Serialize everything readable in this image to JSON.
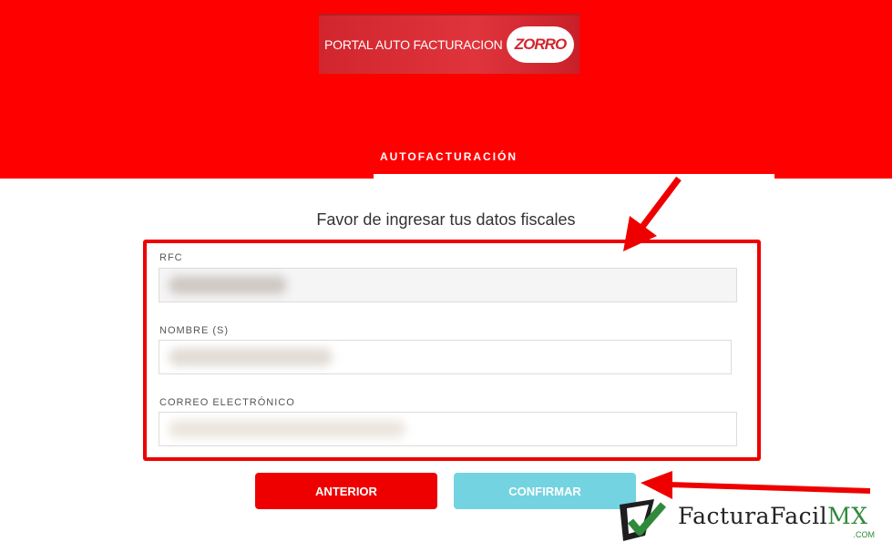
{
  "header": {
    "logo_text": "PORTAL AUTO FACTURACION",
    "logo_brand": "ZORRO",
    "section_title": "AUTOFACTURACIÓN"
  },
  "form": {
    "subtitle": "Favor de ingresar tus datos fiscales",
    "fields": [
      {
        "label": "RFC",
        "value": ""
      },
      {
        "label": "NOMBRE (S)",
        "value": ""
      },
      {
        "label": "CORREO ELECTRÓNICO",
        "value": ""
      }
    ]
  },
  "buttons": {
    "previous": "ANTERIOR",
    "confirm": "CONFIRMAR"
  },
  "watermark": {
    "name": "FacturaFacil",
    "suffix": "MX",
    "domain": ".COM"
  },
  "colors": {
    "header_red": "#ff0000",
    "button_red": "#ee0000",
    "button_confirm": "#74d3e0",
    "brand_green": "#2f8a3a"
  }
}
